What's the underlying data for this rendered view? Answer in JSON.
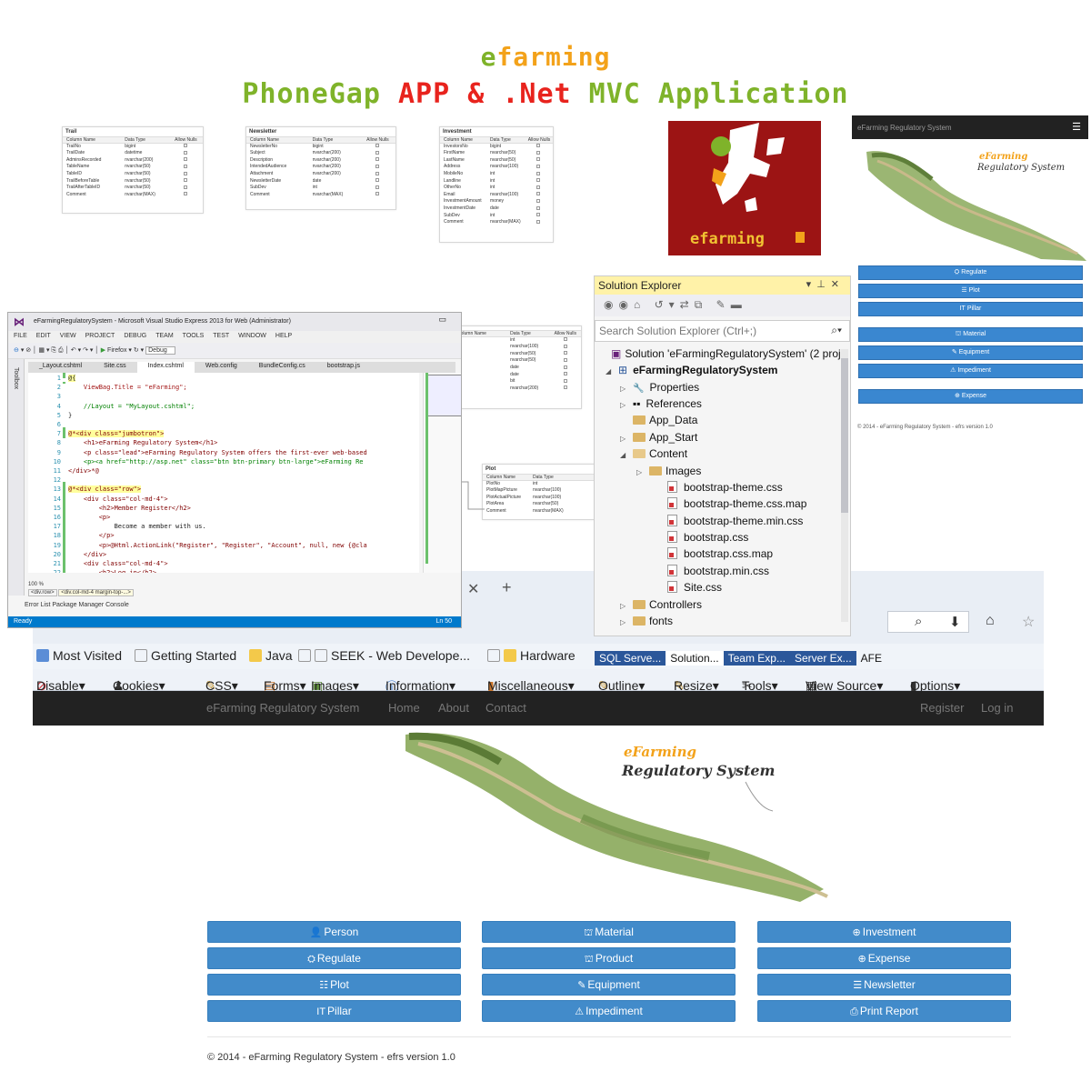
{
  "title": {
    "line1": {
      "e": "e",
      "farming": "farming"
    },
    "line2": {
      "phonegap": "PhoneGap",
      "app": "APP",
      "amp": "&",
      "net": ".Net",
      "mvc": "MVC",
      "application": "Application"
    }
  },
  "db_tables": [
    {
      "name": "Trail",
      "headers": [
        "Column Name",
        "Data Type",
        "Allow Nulls"
      ],
      "rows": [
        [
          "TrailNo",
          "bigint"
        ],
        [
          "TrailDate",
          "datetime"
        ],
        [
          "AdminsRecorded",
          "nvarchar(200)"
        ],
        [
          "TableName",
          "nvarchar(50)"
        ],
        [
          "TableID",
          "nvarchar(50)"
        ],
        [
          "TrailBeforeTable",
          "nvarchar(50)"
        ],
        [
          "TrailAfterTableID",
          "nvarchar(50)"
        ],
        [
          "Comment",
          "nvarchar(MAX)"
        ]
      ]
    },
    {
      "name": "Newsletter",
      "headers": [
        "Column Name",
        "Data Type",
        "Allow Nulls"
      ],
      "rows": [
        [
          "NewsletterNo",
          "bigint"
        ],
        [
          "Subject",
          "nvarchar(200)"
        ],
        [
          "Description",
          "nvarchar(200)"
        ],
        [
          "IntendedAudience",
          "nvarchar(200)"
        ],
        [
          "Attachment",
          "nvarchar(200)"
        ],
        [
          "NewsletterDate",
          "date"
        ],
        [
          "SubDev",
          "int"
        ],
        [
          "Comment",
          "nvarchar(MAX)"
        ]
      ]
    },
    {
      "name": "Investment",
      "headers": [
        "Column Name",
        "Data Type",
        "Allow Nulls"
      ],
      "rows": [
        [
          "InvestorsNo",
          "bigint"
        ],
        [
          "FirstName",
          "nvarchar(50)"
        ],
        [
          "LastName",
          "nvarchar(50)"
        ],
        [
          "Address",
          "nvarchar(100)"
        ],
        [
          "MobileNo",
          "int"
        ],
        [
          "Landline",
          "int"
        ],
        [
          "OtherNo",
          "int"
        ],
        [
          "Email",
          "nvarchar(100)"
        ],
        [
          "InvestmentAmount",
          "money"
        ],
        [
          "InvestmentDate",
          "date"
        ],
        [
          "SubDev",
          "int"
        ],
        [
          "Comment",
          "nvarchar(MAX)"
        ]
      ]
    },
    {
      "name": "",
      "headers": [
        "Column Name",
        "Data Type",
        "Allow Nulls"
      ],
      "rows": [
        [
          "",
          "int"
        ],
        [
          "",
          "nvarchar(100)"
        ],
        [
          "",
          "nvarchar(50)"
        ],
        [
          "",
          "nvarchar(50)"
        ],
        [
          "",
          "date"
        ],
        [
          "",
          "date"
        ],
        [
          "",
          "bit"
        ],
        [
          "",
          "nvarchar(200)"
        ]
      ]
    },
    {
      "name": "Plot",
      "headers": [
        "Column Name",
        "Data Type"
      ],
      "rows": [
        [
          "PlotNo",
          "int"
        ],
        [
          "PlotMapPicture",
          "nvarchar(100)"
        ],
        [
          "PlotActualPicture",
          "nvarchar(100)"
        ],
        [
          "PlotArea",
          "nvarchar(50)"
        ],
        [
          "Comment",
          "nvarchar(MAX)"
        ]
      ]
    }
  ],
  "logo": {
    "text": "efarming"
  },
  "mobile": {
    "brand": "eFarming Regulatory System",
    "menu_icon": "☰",
    "logo_line1": "eFarming",
    "logo_line2": "Regulatory System",
    "buttons": [
      {
        "icon": "⛭",
        "label": "Regulate"
      },
      {
        "icon": "☰",
        "label": "Plot"
      },
      {
        "icon": "IT",
        "label": "Pillar"
      },
      {
        "icon": "⛫",
        "label": "Material"
      },
      {
        "icon": "✎",
        "label": "Equipment"
      },
      {
        "icon": "⚠",
        "label": "Impediment"
      },
      {
        "icon": "⊕",
        "label": "Expense"
      }
    ],
    "footer": "© 2014 - eFarming Regulatory System - efrs version 1.0"
  },
  "vs": {
    "title": "eFarmingRegulatorySystem - Microsoft Visual Studio Express 2013 for Web (Administrator)",
    "menu": [
      "FILE",
      "EDIT",
      "VIEW",
      "PROJECT",
      "DEBUG",
      "TEAM",
      "TOOLS",
      "TEST",
      "WINDOW",
      "HELP"
    ],
    "browser": "Firefox",
    "config": "Debug",
    "tabs": [
      "_Layout.cshtml",
      "Site.css",
      "Index.cshtml",
      "Web.config",
      "BundleConfig.cs",
      "bootstrap.js"
    ],
    "toolbox": "Toolbox",
    "code": [
      {
        "n": "1",
        "t": "@{"
      },
      {
        "n": "2",
        "t": "    ViewBag.Title = \"eFarming\";"
      },
      {
        "n": "3",
        "t": ""
      },
      {
        "n": "4",
        "t": "    //Layout = \"MyLayout.cshtml\";"
      },
      {
        "n": "5",
        "t": "}"
      },
      {
        "n": "6",
        "t": ""
      },
      {
        "n": "7",
        "t": "@*<div class=\"jumbotron\">"
      },
      {
        "n": "8",
        "t": "    <h1>eFarming Regulatory System</h1>"
      },
      {
        "n": "9",
        "t": "    <p class=\"lead\">eFarming Regulatory System offers the first-ever web-based"
      },
      {
        "n": "10",
        "t": "    <p><a href=\"http://asp.net\" class=\"btn btn-primary btn-large\">eFarming Re"
      },
      {
        "n": "11",
        "t": "</div>*@"
      },
      {
        "n": "12",
        "t": ""
      },
      {
        "n": "13",
        "t": "@*<div class=\"row\">"
      },
      {
        "n": "14",
        "t": "    <div class=\"col-md-4\">"
      },
      {
        "n": "15",
        "t": "        <h2>Member Register</h2>"
      },
      {
        "n": "16",
        "t": "        <p>"
      },
      {
        "n": "17",
        "t": "            Become a member with us."
      },
      {
        "n": "18",
        "t": "        </p>"
      },
      {
        "n": "19",
        "t": "        <p>@Html.ActionLink(\"Register\", \"Register\", \"Account\", null, new {@cla"
      },
      {
        "n": "20",
        "t": "    </div>"
      },
      {
        "n": "21",
        "t": "    <div class=\"col-md-4\">"
      },
      {
        "n": "22",
        "t": "        <h2>Log in</h2>"
      }
    ],
    "zoom": "100 %",
    "breadcrumb1": "<div.row>",
    "breadcrumb2": "<div.col-md-4 margin-top-...>",
    "bottom_tabs": "Error List   Package Manager Console",
    "status": "Ready",
    "status_right": "Ln 50"
  },
  "solution_explorer": {
    "title": "Solution Explorer",
    "search_placeholder": "Search Solution Explorer (Ctrl+;)",
    "solution": "Solution 'eFarmingRegulatorySystem' (2 proj",
    "project": "eFarmingRegulatorySystem",
    "items": [
      "Properties",
      "References",
      "App_Data",
      "App_Start",
      "Content",
      "Images",
      "bootstrap-theme.css",
      "bootstrap-theme.css.map",
      "bootstrap-theme.min.css",
      "bootstrap.css",
      "bootstrap.css.map",
      "bootstrap.min.css",
      "Site.css",
      "Controllers",
      "fonts"
    ]
  },
  "se_tabs": [
    "SQL Serve...",
    "Solution...",
    "Team Exp...",
    "Server Ex...",
    "AFE"
  ],
  "firefox": {
    "bookmarks": [
      "Most Visited",
      "Getting Started",
      "Java",
      "SEEK - Web Develope...",
      "Hardware"
    ],
    "devbar": [
      "Disable▾",
      "Cookies▾",
      "CSS▾",
      "Forms▾",
      "Images▾",
      "Information▾",
      "Miscellaneous▾",
      "Outline▾",
      "Resize▾",
      "Tools▾",
      "View Source▾",
      "Options▾"
    ]
  },
  "site": {
    "brand": "eFarming Regulatory System",
    "nav": [
      "Home",
      "About",
      "Contact"
    ],
    "nav_right": [
      "Register",
      "Log in"
    ],
    "logo_line1": "eFarming",
    "logo_line2": "Regulatory System",
    "buttons": [
      {
        "icon": "👤",
        "label": "Person"
      },
      {
        "icon": "⛫",
        "label": "Material"
      },
      {
        "icon": "⊕",
        "label": "Investment"
      },
      {
        "icon": "⛭",
        "label": "Regulate"
      },
      {
        "icon": "⛫",
        "label": "Product"
      },
      {
        "icon": "⊕",
        "label": "Expense"
      },
      {
        "icon": "☷",
        "label": "Plot"
      },
      {
        "icon": "✎",
        "label": "Equipment"
      },
      {
        "icon": "☰",
        "label": "Newsletter"
      },
      {
        "icon": "IT",
        "label": "Pillar"
      },
      {
        "icon": "⚠",
        "label": "Impediment"
      },
      {
        "icon": "⎙",
        "label": "Print Report"
      }
    ],
    "footer": "© 2014 - eFarming Regulatory System - efrs version 1.0"
  }
}
